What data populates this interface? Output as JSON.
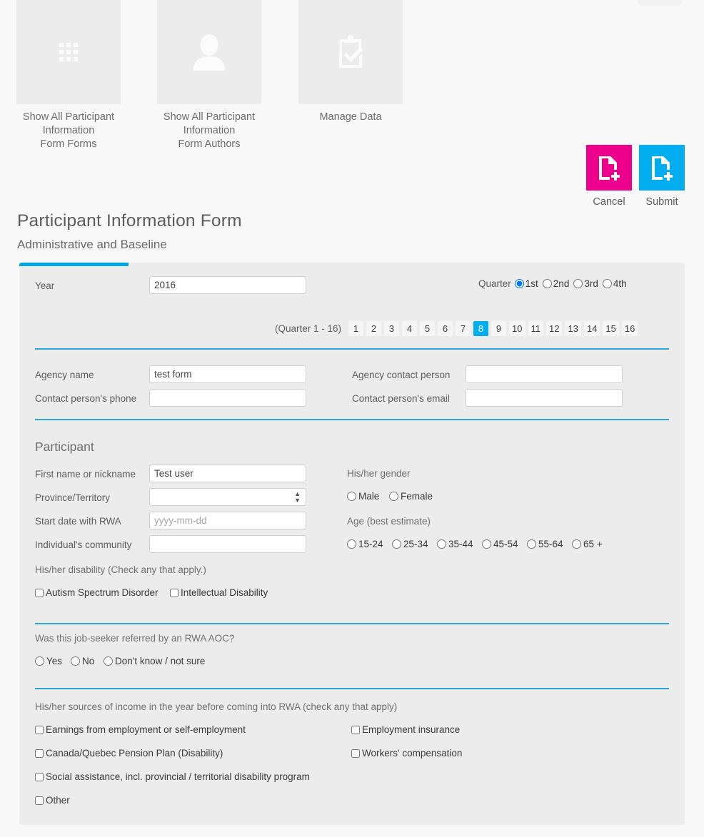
{
  "tiles": [
    {
      "icon": "grid-icon",
      "label": "Show All Participant Information\nForm Forms"
    },
    {
      "icon": "person-icon",
      "label": "Show All Participant Information\nForm Authors"
    },
    {
      "icon": "clipboard-check-icon",
      "label": "Manage Data"
    }
  ],
  "actions": {
    "cancel": {
      "label": "Cancel",
      "color": "#ec008c",
      "icon": "document-plus-icon"
    },
    "submit": {
      "label": "Submit",
      "color": "#00aeef",
      "icon": "document-plus-icon"
    }
  },
  "header": {
    "title": "Participant Information Form",
    "subtitle": "Administrative and Baseline"
  },
  "form": {
    "year": {
      "label": "Year",
      "value": "2016"
    },
    "quarter": {
      "label": "Quarter",
      "options": [
        "1st",
        "2nd",
        "3rd",
        "4th"
      ],
      "selected": "1st"
    },
    "quarter_range": {
      "label": "(Quarter 1 - 16)",
      "numbers": [
        "1",
        "2",
        "3",
        "4",
        "5",
        "6",
        "7",
        "8",
        "9",
        "10",
        "11",
        "12",
        "13",
        "14",
        "15",
        "16"
      ],
      "selected": "8"
    },
    "agency": {
      "name": {
        "label": "Agency name",
        "value": "test form"
      },
      "contact_person": {
        "label": "Agency contact person",
        "value": ""
      },
      "phone": {
        "label": "Contact person's phone",
        "value": ""
      },
      "email": {
        "label": "Contact person's email",
        "value": ""
      }
    },
    "participant": {
      "section_title": "Participant",
      "first_name": {
        "label": "First name or nickname",
        "value": "Test user"
      },
      "province": {
        "label": "Province/Territory",
        "value": ""
      },
      "start_date": {
        "label": "Start date with RWA",
        "placeholder": "yyyy-mm-dd",
        "value": ""
      },
      "community": {
        "label": "Individual's community",
        "value": ""
      },
      "gender": {
        "label": "His/her gender",
        "options": [
          "Male",
          "Female"
        ],
        "selected": ""
      },
      "age": {
        "label": "Age (best estimate)",
        "options": [
          "15-24",
          "25-34",
          "35-44",
          "45-54",
          "55-64",
          "65 +"
        ],
        "selected": ""
      }
    },
    "disability": {
      "label": "His/her disability (Check any that apply.)",
      "options": [
        "Autism Spectrum Disorder",
        "Intellectual Disability"
      ]
    },
    "referral": {
      "label": "Was this job-seeker referred by an RWA AOC?",
      "options": [
        "Yes",
        "No",
        "Don't know / not sure"
      ],
      "selected": ""
    },
    "income": {
      "label": "His/her sources of income in the year before coming into RWA (check any that apply)",
      "options_left": [
        "Earnings from employment or self-employment",
        "Canada/Quebec Pension Plan (Disability)",
        "Social assistance, incl. provincial / territorial disability program",
        "Other"
      ],
      "options_right": [
        "Employment insurance",
        "Workers' compensation"
      ]
    }
  },
  "colors": {
    "accent_blue": "#00aeef",
    "divider_blue": "#29a8d8",
    "cancel_pink": "#ec008c",
    "page_bg": "#f8f8f8",
    "card_bg": "#ececec"
  }
}
